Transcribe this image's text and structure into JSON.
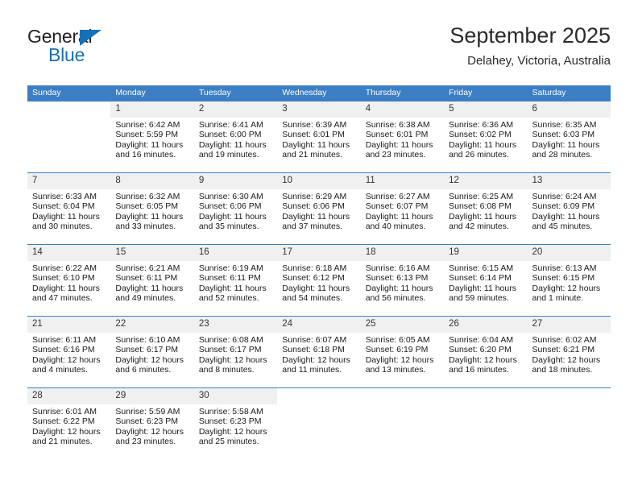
{
  "brand": {
    "name_top": "General",
    "name_bottom": "Blue",
    "triangle_color": "#1670b8"
  },
  "header": {
    "title": "September 2025",
    "subtitle": "Delahey, Victoria, Australia"
  },
  "theme": {
    "accent": "#3b7ec4",
    "daynum_bg": "#f0f0f0",
    "text": "#1a1a1a"
  },
  "calendar": {
    "weekday_headers": [
      "Sunday",
      "Monday",
      "Tuesday",
      "Wednesday",
      "Thursday",
      "Friday",
      "Saturday"
    ],
    "weeks": [
      [
        {
          "day": "",
          "sunrise": "",
          "sunset": "",
          "daylight_1": "",
          "daylight_2": "",
          "blank": true
        },
        {
          "day": "1",
          "sunrise": "Sunrise: 6:42 AM",
          "sunset": "Sunset: 5:59 PM",
          "daylight_1": "Daylight: 11 hours",
          "daylight_2": "and 16 minutes."
        },
        {
          "day": "2",
          "sunrise": "Sunrise: 6:41 AM",
          "sunset": "Sunset: 6:00 PM",
          "daylight_1": "Daylight: 11 hours",
          "daylight_2": "and 19 minutes."
        },
        {
          "day": "3",
          "sunrise": "Sunrise: 6:39 AM",
          "sunset": "Sunset: 6:01 PM",
          "daylight_1": "Daylight: 11 hours",
          "daylight_2": "and 21 minutes."
        },
        {
          "day": "4",
          "sunrise": "Sunrise: 6:38 AM",
          "sunset": "Sunset: 6:01 PM",
          "daylight_1": "Daylight: 11 hours",
          "daylight_2": "and 23 minutes."
        },
        {
          "day": "5",
          "sunrise": "Sunrise: 6:36 AM",
          "sunset": "Sunset: 6:02 PM",
          "daylight_1": "Daylight: 11 hours",
          "daylight_2": "and 26 minutes."
        },
        {
          "day": "6",
          "sunrise": "Sunrise: 6:35 AM",
          "sunset": "Sunset: 6:03 PM",
          "daylight_1": "Daylight: 11 hours",
          "daylight_2": "and 28 minutes."
        }
      ],
      [
        {
          "day": "7",
          "sunrise": "Sunrise: 6:33 AM",
          "sunset": "Sunset: 6:04 PM",
          "daylight_1": "Daylight: 11 hours",
          "daylight_2": "and 30 minutes."
        },
        {
          "day": "8",
          "sunrise": "Sunrise: 6:32 AM",
          "sunset": "Sunset: 6:05 PM",
          "daylight_1": "Daylight: 11 hours",
          "daylight_2": "and 33 minutes."
        },
        {
          "day": "9",
          "sunrise": "Sunrise: 6:30 AM",
          "sunset": "Sunset: 6:06 PM",
          "daylight_1": "Daylight: 11 hours",
          "daylight_2": "and 35 minutes."
        },
        {
          "day": "10",
          "sunrise": "Sunrise: 6:29 AM",
          "sunset": "Sunset: 6:06 PM",
          "daylight_1": "Daylight: 11 hours",
          "daylight_2": "and 37 minutes."
        },
        {
          "day": "11",
          "sunrise": "Sunrise: 6:27 AM",
          "sunset": "Sunset: 6:07 PM",
          "daylight_1": "Daylight: 11 hours",
          "daylight_2": "and 40 minutes."
        },
        {
          "day": "12",
          "sunrise": "Sunrise: 6:25 AM",
          "sunset": "Sunset: 6:08 PM",
          "daylight_1": "Daylight: 11 hours",
          "daylight_2": "and 42 minutes."
        },
        {
          "day": "13",
          "sunrise": "Sunrise: 6:24 AM",
          "sunset": "Sunset: 6:09 PM",
          "daylight_1": "Daylight: 11 hours",
          "daylight_2": "and 45 minutes."
        }
      ],
      [
        {
          "day": "14",
          "sunrise": "Sunrise: 6:22 AM",
          "sunset": "Sunset: 6:10 PM",
          "daylight_1": "Daylight: 11 hours",
          "daylight_2": "and 47 minutes."
        },
        {
          "day": "15",
          "sunrise": "Sunrise: 6:21 AM",
          "sunset": "Sunset: 6:11 PM",
          "daylight_1": "Daylight: 11 hours",
          "daylight_2": "and 49 minutes."
        },
        {
          "day": "16",
          "sunrise": "Sunrise: 6:19 AM",
          "sunset": "Sunset: 6:11 PM",
          "daylight_1": "Daylight: 11 hours",
          "daylight_2": "and 52 minutes."
        },
        {
          "day": "17",
          "sunrise": "Sunrise: 6:18 AM",
          "sunset": "Sunset: 6:12 PM",
          "daylight_1": "Daylight: 11 hours",
          "daylight_2": "and 54 minutes."
        },
        {
          "day": "18",
          "sunrise": "Sunrise: 6:16 AM",
          "sunset": "Sunset: 6:13 PM",
          "daylight_1": "Daylight: 11 hours",
          "daylight_2": "and 56 minutes."
        },
        {
          "day": "19",
          "sunrise": "Sunrise: 6:15 AM",
          "sunset": "Sunset: 6:14 PM",
          "daylight_1": "Daylight: 11 hours",
          "daylight_2": "and 59 minutes."
        },
        {
          "day": "20",
          "sunrise": "Sunrise: 6:13 AM",
          "sunset": "Sunset: 6:15 PM",
          "daylight_1": "Daylight: 12 hours",
          "daylight_2": "and 1 minute."
        }
      ],
      [
        {
          "day": "21",
          "sunrise": "Sunrise: 6:11 AM",
          "sunset": "Sunset: 6:16 PM",
          "daylight_1": "Daylight: 12 hours",
          "daylight_2": "and 4 minutes."
        },
        {
          "day": "22",
          "sunrise": "Sunrise: 6:10 AM",
          "sunset": "Sunset: 6:17 PM",
          "daylight_1": "Daylight: 12 hours",
          "daylight_2": "and 6 minutes."
        },
        {
          "day": "23",
          "sunrise": "Sunrise: 6:08 AM",
          "sunset": "Sunset: 6:17 PM",
          "daylight_1": "Daylight: 12 hours",
          "daylight_2": "and 8 minutes."
        },
        {
          "day": "24",
          "sunrise": "Sunrise: 6:07 AM",
          "sunset": "Sunset: 6:18 PM",
          "daylight_1": "Daylight: 12 hours",
          "daylight_2": "and 11 minutes."
        },
        {
          "day": "25",
          "sunrise": "Sunrise: 6:05 AM",
          "sunset": "Sunset: 6:19 PM",
          "daylight_1": "Daylight: 12 hours",
          "daylight_2": "and 13 minutes."
        },
        {
          "day": "26",
          "sunrise": "Sunrise: 6:04 AM",
          "sunset": "Sunset: 6:20 PM",
          "daylight_1": "Daylight: 12 hours",
          "daylight_2": "and 16 minutes."
        },
        {
          "day": "27",
          "sunrise": "Sunrise: 6:02 AM",
          "sunset": "Sunset: 6:21 PM",
          "daylight_1": "Daylight: 12 hours",
          "daylight_2": "and 18 minutes."
        }
      ],
      [
        {
          "day": "28",
          "sunrise": "Sunrise: 6:01 AM",
          "sunset": "Sunset: 6:22 PM",
          "daylight_1": "Daylight: 12 hours",
          "daylight_2": "and 21 minutes."
        },
        {
          "day": "29",
          "sunrise": "Sunrise: 5:59 AM",
          "sunset": "Sunset: 6:23 PM",
          "daylight_1": "Daylight: 12 hours",
          "daylight_2": "and 23 minutes."
        },
        {
          "day": "30",
          "sunrise": "Sunrise: 5:58 AM",
          "sunset": "Sunset: 6:23 PM",
          "daylight_1": "Daylight: 12 hours",
          "daylight_2": "and 25 minutes."
        },
        {
          "day": "",
          "sunrise": "",
          "sunset": "",
          "daylight_1": "",
          "daylight_2": "",
          "blank": true
        },
        {
          "day": "",
          "sunrise": "",
          "sunset": "",
          "daylight_1": "",
          "daylight_2": "",
          "blank": true
        },
        {
          "day": "",
          "sunrise": "",
          "sunset": "",
          "daylight_1": "",
          "daylight_2": "",
          "blank": true
        },
        {
          "day": "",
          "sunrise": "",
          "sunset": "",
          "daylight_1": "",
          "daylight_2": "",
          "blank": true
        }
      ]
    ]
  }
}
